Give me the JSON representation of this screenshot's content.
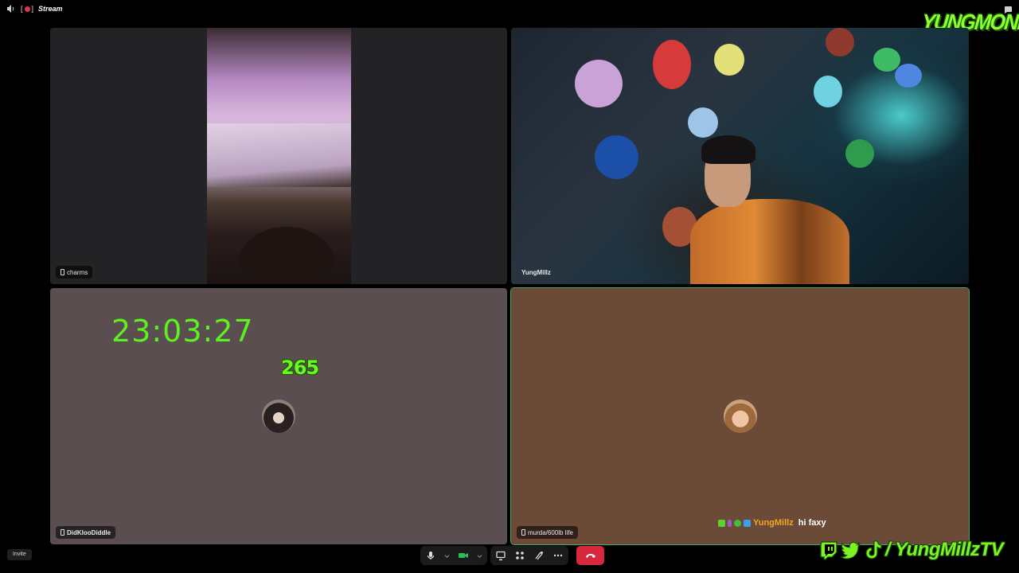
{
  "window": {
    "title": "Stream",
    "icons": [
      "speaker-icon",
      "record-indicator-icon",
      "chat-bubble-icon"
    ]
  },
  "overlay": {
    "logo_text": "YUNGMONEY",
    "social_handle": "/ YungMillzTV",
    "accent": "#6df524"
  },
  "tiles": [
    {
      "name": "charms",
      "mobile": true
    },
    {
      "name": "YungMillz",
      "mobile": false
    },
    {
      "name": "DidKlooDiddle",
      "mobile": true,
      "timer": "23:03:27",
      "counter": "265"
    },
    {
      "name": "murda/600lb life",
      "mobile": true
    }
  ],
  "chat": {
    "user": "YungMillz",
    "message": "hi faxy"
  },
  "footer": {
    "invite_label": "Invite"
  },
  "colors": {
    "hangup": "#d8283e",
    "speaking_outline": "#3fae5d",
    "chat_user": "#f5a623"
  }
}
